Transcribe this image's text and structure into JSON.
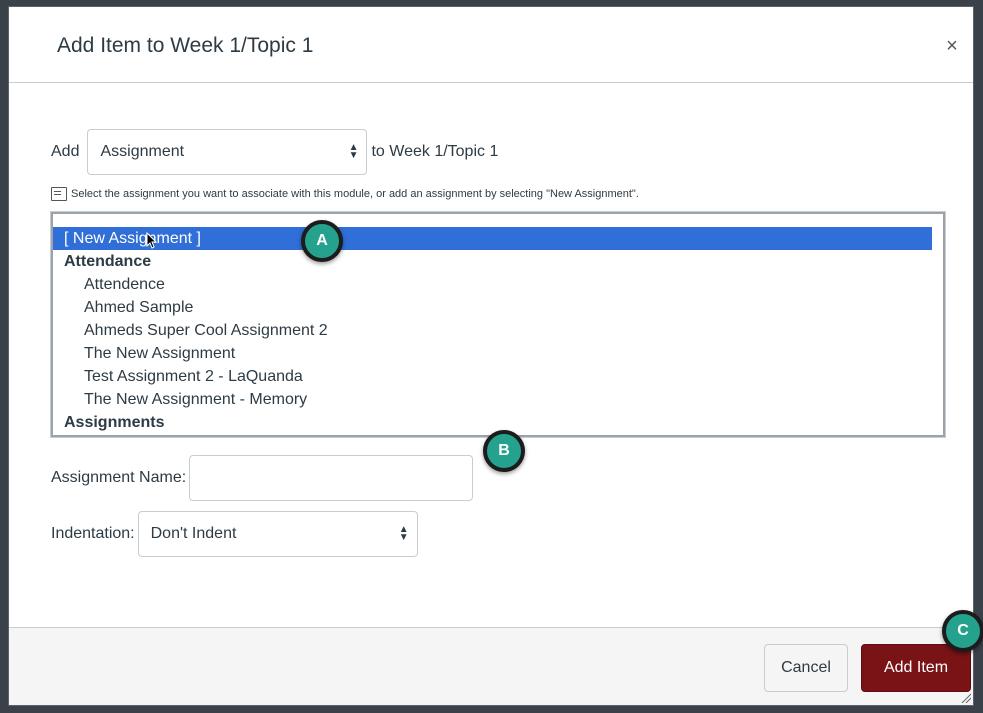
{
  "dialog": {
    "title": "Add Item to Week 1/Topic 1",
    "close_glyph": "×"
  },
  "add_row": {
    "label": "Add",
    "type_value": "Assignment",
    "suffix": "to Week 1/Topic 1"
  },
  "hint": "Select the assignment you want to associate with this module, or add an assignment by selecting \"New Assignment\".",
  "list": {
    "options": [
      {
        "text": "[ New Assignment ]",
        "kind": "selected"
      },
      {
        "text": "Attendance",
        "kind": "group"
      },
      {
        "text": "Attendence",
        "kind": "item"
      },
      {
        "text": "Ahmed Sample",
        "kind": "item"
      },
      {
        "text": "Ahmeds Super Cool Assignment 2",
        "kind": "item"
      },
      {
        "text": "The New Assignment",
        "kind": "item"
      },
      {
        "text": "Test Assignment 2 - LaQuanda",
        "kind": "item"
      },
      {
        "text": "The New Assignment - Memory",
        "kind": "item"
      },
      {
        "text": "Assignments",
        "kind": "group"
      }
    ]
  },
  "name_row": {
    "label": "Assignment Name:",
    "value": ""
  },
  "indent_row": {
    "label": "Indentation:",
    "value": "Don't Indent"
  },
  "footer": {
    "cancel_label": "Cancel",
    "add_label": "Add Item"
  },
  "badges": {
    "a": "A",
    "b": "B",
    "c": "C"
  },
  "colors": {
    "primary_button": "#7a1316",
    "selection": "#2f6fd7",
    "badge": "#25a28d"
  }
}
